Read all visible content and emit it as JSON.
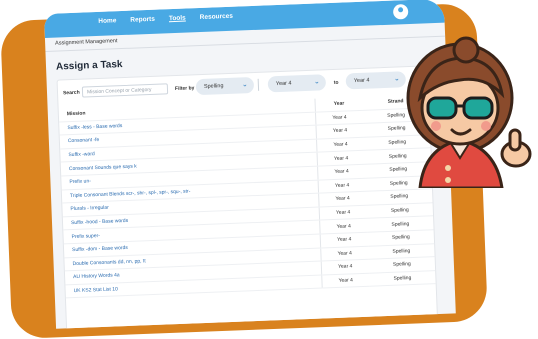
{
  "nav": {
    "items": [
      {
        "label": "Home",
        "active": false
      },
      {
        "label": "Reports",
        "active": false
      },
      {
        "label": "Tools",
        "active": true
      },
      {
        "label": "Resources",
        "active": false
      }
    ]
  },
  "breadcrumb": "Assignment Management",
  "page_title": "Assign a Task",
  "filters": {
    "search_label": "Search",
    "search_placeholder": "Mission Concept or Category",
    "filter_label": "Filter by",
    "strand_value": "Spelling",
    "year_from_value": "Year 4",
    "to_label": "to",
    "year_to_value": "Year 4"
  },
  "table": {
    "headers": [
      "Mission",
      "Year",
      "Strand"
    ],
    "rows": [
      [
        "Suffix -less - Base words",
        "Year 4",
        "Spelling"
      ],
      [
        "Consonant -fe",
        "Year 4",
        "Spelling"
      ],
      [
        "Suffix -ward",
        "Year 4",
        "Spelling"
      ],
      [
        "Consonant Sounds que says k",
        "Year 4",
        "Spelling"
      ],
      [
        "Prefix un-",
        "Year 4",
        "Spelling"
      ],
      [
        "Triple Consonant Blends scr-, shr-, spl-, spr-, squ-, str-",
        "Year 4",
        "Spelling"
      ],
      [
        "Plurals - Irregular",
        "Year 4",
        "Spelling"
      ],
      [
        "Suffix -hood - Base words",
        "Year 4",
        "Spelling"
      ],
      [
        "Prefix super-",
        "Year 4",
        "Spelling"
      ],
      [
        "Suffix -dom - Base words",
        "Year 4",
        "Spelling"
      ],
      [
        "Double Consonants dd, nn, pp, tt",
        "Year 4",
        "Spelling"
      ],
      [
        "AU History Words 4a",
        "Year 4",
        "Spelling"
      ],
      [
        "UK KS2 Stat List 10",
        "Year 4",
        "Spelling"
      ]
    ]
  },
  "colors": {
    "frame": "#d9821e",
    "nav_bar": "#49a9e4",
    "link": "#2b6cb0"
  }
}
